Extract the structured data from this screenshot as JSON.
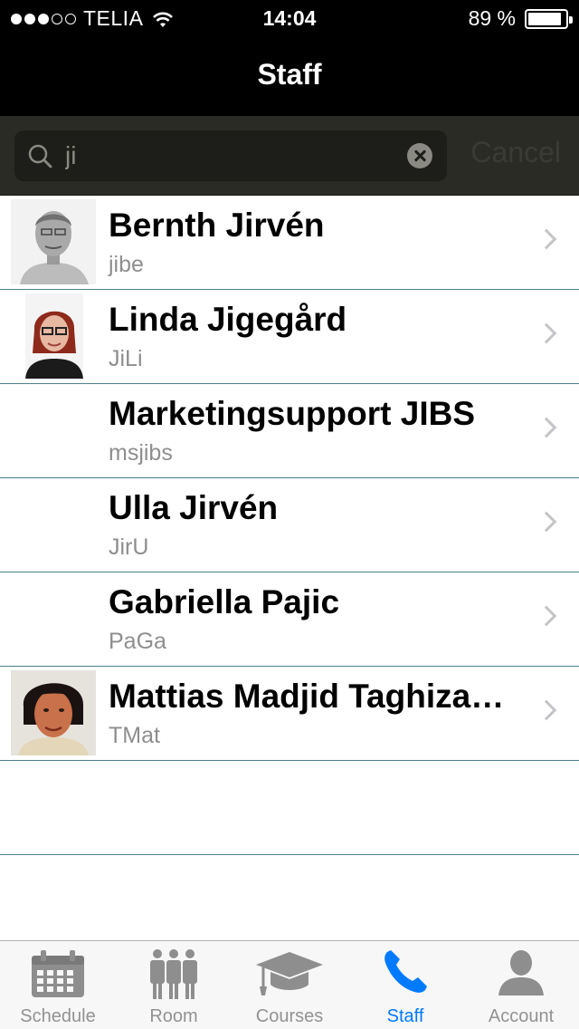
{
  "status_bar": {
    "signal_filled": 3,
    "signal_total": 5,
    "carrier": "TELIA",
    "time": "14:04",
    "battery_text": "89 %",
    "battery_level": 0.89
  },
  "nav": {
    "title": "Staff"
  },
  "search": {
    "value": "ji",
    "cancel_label": "Cancel"
  },
  "staff": [
    {
      "name": "Bernth Jirvén",
      "username": "jibe",
      "has_photo": true,
      "photo": "avatar-man-grey"
    },
    {
      "name": "Linda Jigegård",
      "username": "JiLi",
      "has_photo": true,
      "photo": "avatar-woman-red-hair"
    },
    {
      "name": "Marketingsupport JIBS",
      "username": "msjibs",
      "has_photo": false
    },
    {
      "name": "Ulla Jirvén",
      "username": "JirU",
      "has_photo": false
    },
    {
      "name": "Gabriella Pajic",
      "username": "PaGa",
      "has_photo": false
    },
    {
      "name": "Mattias Madjid Taghiza…",
      "username": "TMat",
      "has_photo": true,
      "photo": "avatar-man-dark-hair"
    }
  ],
  "tabs": [
    {
      "label": "Schedule",
      "icon": "calendar-icon",
      "active": false
    },
    {
      "label": "Room",
      "icon": "people-icon",
      "active": false
    },
    {
      "label": "Courses",
      "icon": "graduation-cap-icon",
      "active": false
    },
    {
      "label": "Staff",
      "icon": "phone-icon",
      "active": true
    },
    {
      "label": "Account",
      "icon": "person-icon",
      "active": false
    }
  ],
  "colors": {
    "active_tab": "#007aff",
    "inactive_tab": "#929292",
    "separator": "#4a7f8f"
  }
}
